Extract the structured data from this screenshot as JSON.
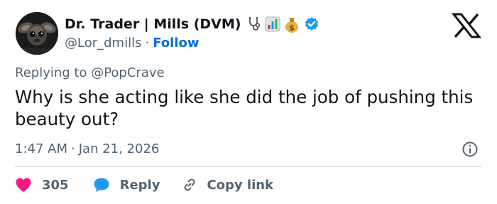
{
  "author": {
    "display_name": "Dr. Trader | Mills (DVM)",
    "emojis": [
      "stethoscope-icon",
      "bar-chart-icon",
      "money-bag-icon"
    ],
    "verified": true,
    "handle": "@Lor_dmills",
    "separator": "·",
    "follow_label": "Follow",
    "avatar_icon": "gremlin-avatar"
  },
  "platform": {
    "logo": "x-logo-icon"
  },
  "tweet": {
    "replying_to": "Replying to @PopCrave",
    "text": "Why is she acting like she did the job of pushing this beauty out?",
    "time": "1:47 AM",
    "date_separator": "·",
    "date": "Jan 21, 2026"
  },
  "actions": {
    "likes_count": "305",
    "reply_label": "Reply",
    "copy_link_label": "Copy link"
  },
  "colors": {
    "text": "#0f1419",
    "secondary": "#536471",
    "link": "#006fd6",
    "verified": "#1d9bf0",
    "heart": "#f91880",
    "divider": "#cfd9de"
  }
}
